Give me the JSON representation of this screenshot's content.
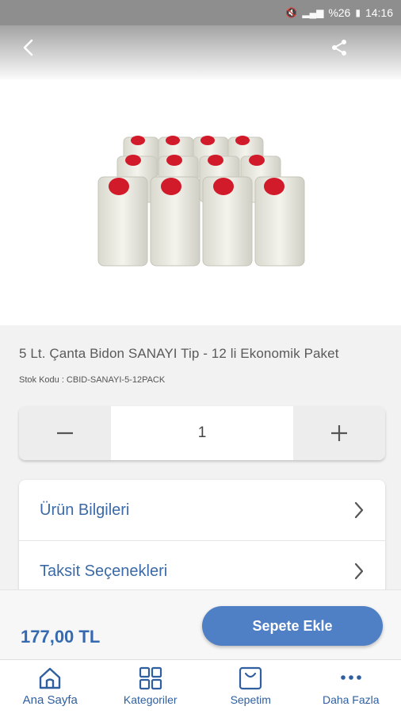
{
  "status_bar": {
    "battery": "%26",
    "time": "14:16"
  },
  "header": {
    "back_icon": "chevron-left-icon",
    "share_icon": "share-icon"
  },
  "product": {
    "title": "5 Lt. Çanta Bidon SANAYI Tip - 12 li  Ekonomik Paket",
    "stock_code": "Stok Kodu : CBID-SANAYI-5-12PACK"
  },
  "quantity": {
    "value": "1"
  },
  "menu": {
    "items": [
      {
        "label": "Ürün Bilgileri"
      },
      {
        "label": "Taksit Seçenekleri"
      }
    ]
  },
  "purchase": {
    "price": "177,00 TL",
    "add_to_cart_label": "Sepete Ekle"
  },
  "nav": {
    "items": [
      {
        "label": "Ana Sayfa",
        "icon": "home-icon",
        "active": true
      },
      {
        "label": "Kategoriler",
        "icon": "grid-icon"
      },
      {
        "label": "Sepetim",
        "icon": "bag-icon"
      },
      {
        "label": "Daha Fazla",
        "icon": "more-icon"
      }
    ]
  },
  "colors": {
    "accent": "#356ab0",
    "button": "#4f7fc4",
    "cap_red": "#d11a2a"
  }
}
